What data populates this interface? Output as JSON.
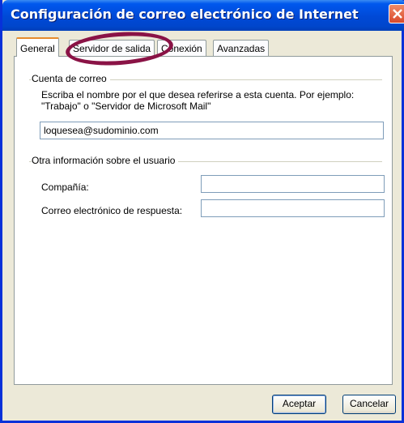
{
  "window": {
    "title": "Configuración de correo electrónico de Internet"
  },
  "tabs": [
    {
      "label": "General",
      "active": true
    },
    {
      "label": "Servidor de salida",
      "active": false
    },
    {
      "label": "Conexión",
      "active": false
    },
    {
      "label": "Avanzadas",
      "active": false
    }
  ],
  "mail_account": {
    "group_label": "Cuenta de correo",
    "description_line1": "Escriba el nombre por el que desea referirse a esta cuenta. Por ejemplo:",
    "description_line2": "\"Trabajo\" o \"Servidor de Microsoft Mail\"",
    "account_value": "loquesea@sudominio.com"
  },
  "user_info": {
    "group_label": "Otra información sobre el usuario",
    "company_label": "Compañía:",
    "company_value": "",
    "reply_label": "Correo electrónico de respuesta:",
    "reply_value": ""
  },
  "buttons": {
    "ok": "Aceptar",
    "cancel": "Cancelar"
  },
  "colors": {
    "titlebar": "#0054e3",
    "annotation_ellipse": "#8a1346",
    "active_tab_accent": "#e68b2c"
  }
}
